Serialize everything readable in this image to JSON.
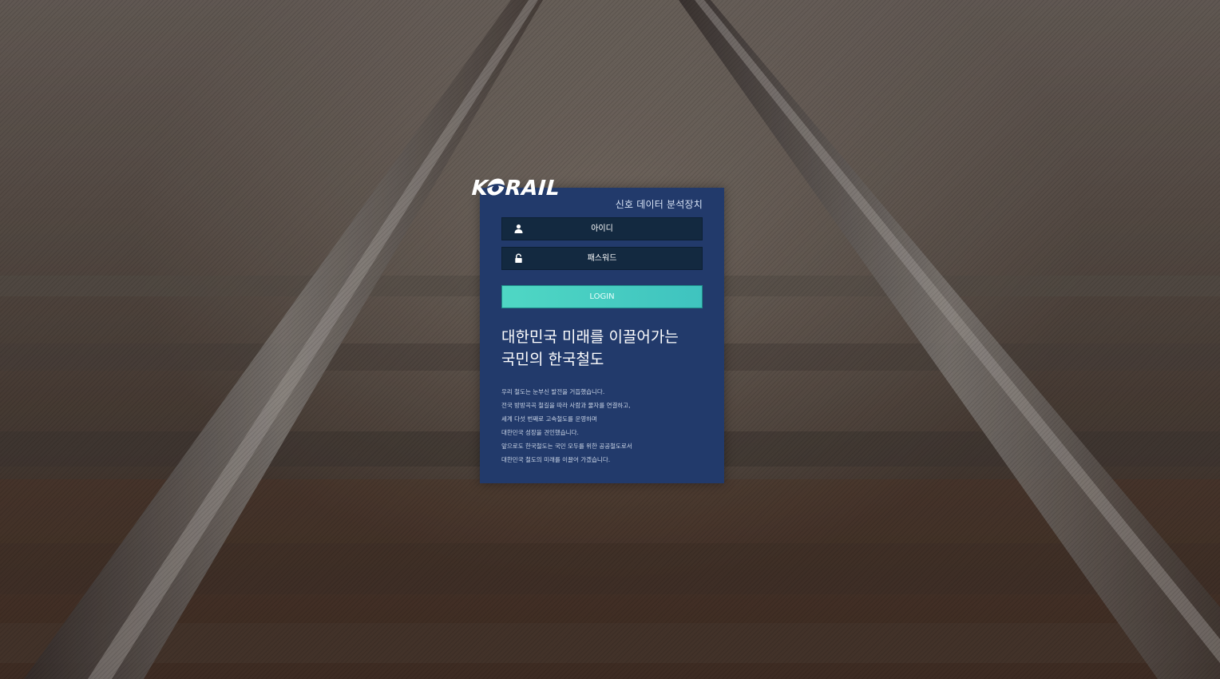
{
  "brand": {
    "logo_text": "KORAIL",
    "accent_color": "#223a6b",
    "button_color": "#4fd7c4"
  },
  "panel": {
    "subtitle": "신호 데이터 분석장치"
  },
  "form": {
    "id_placeholder": "아이디",
    "id_icon": "user-icon",
    "password_placeholder": "패스워드",
    "password_icon": "lock-icon",
    "login_label": "LOGIN"
  },
  "headline": {
    "line1": "대한민국 미래를 이끌어가는",
    "line2": "국민의 한국철도"
  },
  "description": [
    "우리 철도는 눈부신 발전을 거듭했습니다.",
    "전국 방방곡곡 철길을 따라 사람과 물자를 연결하고,",
    "세계 다섯 번째로 고속철도를 운영하며",
    "대한민국 성장을 견인했습니다.",
    "앞으로도 한국철도는 국민 모두를 위한 공공철도로서",
    "대한민국 철도의 미래를 이끌어 가겠습니다."
  ]
}
